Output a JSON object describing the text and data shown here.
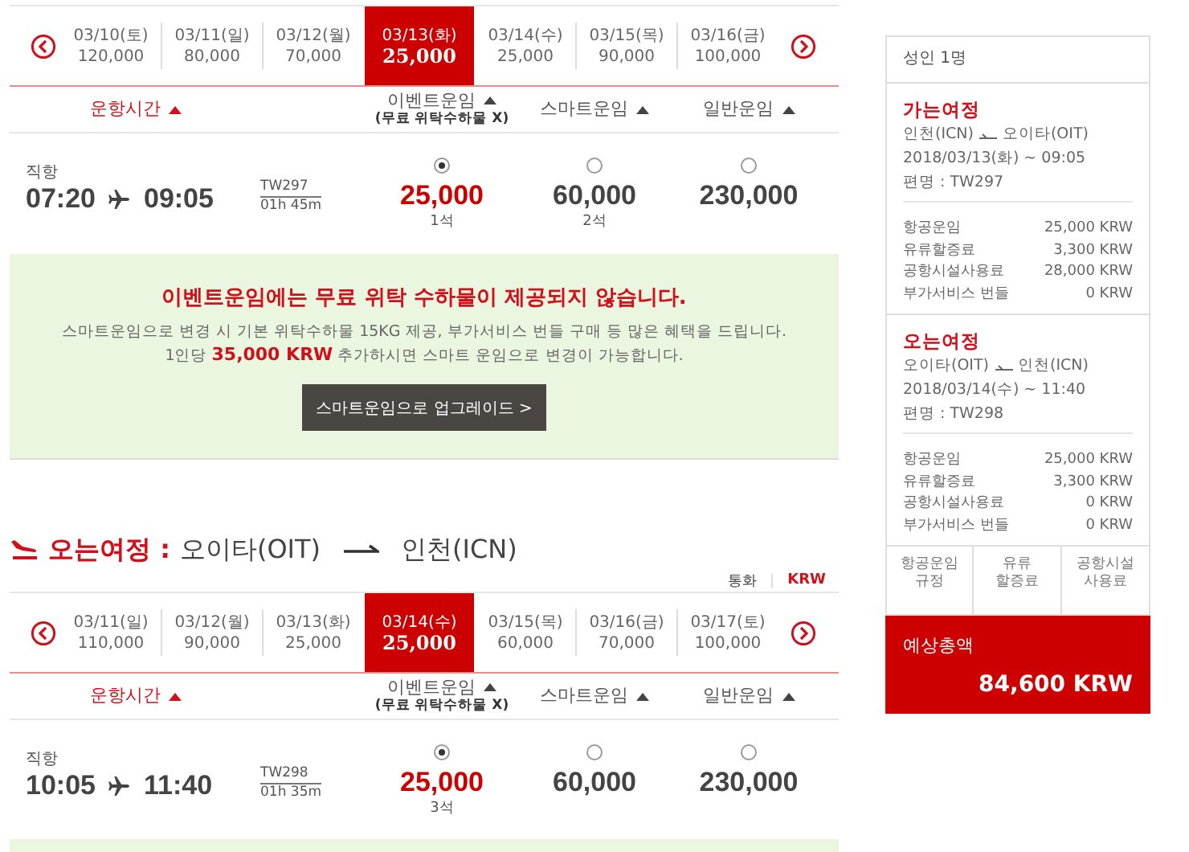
{
  "outbound": {
    "dates": [
      {
        "date": "03/10(토)",
        "price": "120,000",
        "selected": false
      },
      {
        "date": "03/11(일)",
        "price": "80,000",
        "selected": false
      },
      {
        "date": "03/12(월)",
        "price": "70,000",
        "selected": false
      },
      {
        "date": "03/13(화)",
        "price": "25,000",
        "selected": true
      },
      {
        "date": "03/14(수)",
        "price": "25,000",
        "selected": false
      },
      {
        "date": "03/15(목)",
        "price": "90,000",
        "selected": false
      },
      {
        "date": "03/16(금)",
        "price": "100,000",
        "selected": false
      }
    ],
    "columns": [
      {
        "label": "운항시간",
        "active": true
      },
      {
        "label": "이벤트운임",
        "note": "(무료 위탁수하물 X)",
        "active": false
      },
      {
        "label": "스마트운임",
        "active": false
      },
      {
        "label": "일반운임",
        "active": false
      }
    ],
    "flight": {
      "type": "직항",
      "depart": "07:20",
      "arrive": "09:05",
      "flight_no": "TW297",
      "duration": "01h 45m",
      "fares": [
        {
          "price": "25,000",
          "seats": "1석",
          "selected": true
        },
        {
          "price": "60,000",
          "seats": "2석",
          "selected": false
        },
        {
          "price": "230,000",
          "selected": false
        }
      ]
    },
    "notice": {
      "title": "이벤트운임에는 무료 위탁 수하물이 제공되지 않습니다.",
      "lines": [
        "스마트운임으로 변경 시 기본 위탁수하물 15KG 제공, 부가서비스 번들 구매 등 많은 혜택을 드립니다.",
        "1인당 **35,000 KRW** 추가하시면 스마트 운임으로 변경이 가능합니다."
      ],
      "button": "스마트운임으로 업그레이드 >"
    }
  },
  "inbound": {
    "heading": {
      "label": "오는여정 :",
      "from": "오이타(OIT)",
      "to": "인천(ICN)"
    },
    "currency": {
      "label": "통화",
      "value": "KRW"
    },
    "dates": [
      {
        "date": "03/11(일)",
        "price": "110,000",
        "selected": false
      },
      {
        "date": "03/12(월)",
        "price": "90,000",
        "selected": false
      },
      {
        "date": "03/13(화)",
        "price": "25,000",
        "selected": false
      },
      {
        "date": "03/14(수)",
        "price": "25,000",
        "selected": true
      },
      {
        "date": "03/15(목)",
        "price": "60,000",
        "selected": false
      },
      {
        "date": "03/16(금)",
        "price": "70,000",
        "selected": false
      },
      {
        "date": "03/17(토)",
        "price": "100,000",
        "selected": false
      }
    ],
    "columns": [
      {
        "label": "운항시간",
        "active": true
      },
      {
        "label": "이벤트운임",
        "note": "(무료 위탁수하물 X)",
        "active": false
      },
      {
        "label": "스마트운임",
        "active": false
      },
      {
        "label": "일반운임",
        "active": false
      }
    ],
    "flight": {
      "type": "직항",
      "depart": "10:05",
      "arrive": "11:40",
      "flight_no": "TW298",
      "duration": "01h 35m",
      "fares": [
        {
          "price": "25,000",
          "seats": "3석",
          "selected": true
        },
        {
          "price": "60,000",
          "selected": false
        },
        {
          "price": "230,000",
          "selected": false
        }
      ]
    }
  },
  "summary": {
    "passengers": "성인 1명",
    "legs": [
      {
        "title": "가는여정",
        "from": "인천(ICN)",
        "to": "오이타(OIT)",
        "date": "2018/03/13(화) ~ 09:05",
        "flight": "편명 : TW297",
        "charges": [
          {
            "label": "항공운임",
            "amount": "25,000 KRW"
          },
          {
            "label": "유류할증료",
            "amount": "3,300 KRW"
          },
          {
            "label": "공항시설사용료",
            "amount": "28,000 KRW"
          },
          {
            "label": "부가서비스 번들",
            "amount": "0 KRW"
          }
        ]
      },
      {
        "title": "오는여정",
        "from": "오이타(OIT)",
        "to": "인천(ICN)",
        "date": "2018/03/14(수) ~ 11:40",
        "flight": "편명 : TW298",
        "charges": [
          {
            "label": "항공운임",
            "amount": "25,000 KRW"
          },
          {
            "label": "유류할증료",
            "amount": "3,300 KRW"
          },
          {
            "label": "공항시설사용료",
            "amount": "0 KRW"
          },
          {
            "label": "부가서비스 번들",
            "amount": "0 KRW"
          }
        ]
      }
    ],
    "links": [
      "항공운임\n규정",
      "유류\n할증료",
      "공항시설\n사용료"
    ],
    "total": {
      "label": "예상총액",
      "amount": "84,600 KRW"
    }
  }
}
